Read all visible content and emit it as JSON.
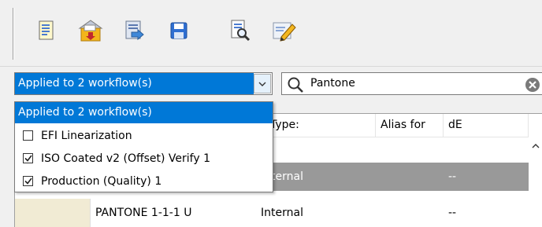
{
  "toolbar": {
    "buttons": [
      {
        "icon": "new-document-icon"
      },
      {
        "icon": "import-folder-icon"
      },
      {
        "icon": "export-icon"
      },
      {
        "icon": "save-icon"
      },
      {
        "icon": "find-in-document-icon"
      },
      {
        "icon": "edit-pencil-icon"
      }
    ]
  },
  "filter": {
    "selected": "Applied to 2 workflow(s)",
    "options": [
      {
        "label": "EFI Linearization",
        "checked": false
      },
      {
        "label": "ISO Coated v2 (Offset) Verify 1",
        "checked": true
      },
      {
        "label": "Production (Quality) 1",
        "checked": true
      }
    ]
  },
  "search": {
    "value": "Pantone"
  },
  "table": {
    "columns": {
      "type": "Type:",
      "alias": "Alias for",
      "de": "dE"
    },
    "rows": [
      {
        "name": "",
        "type": "Internal",
        "alias": "",
        "de": "--",
        "selected": true
      },
      {
        "name": "PANTONE 1-1-1 U",
        "type": "Internal",
        "alias": "",
        "de": "--",
        "selected": false
      }
    ]
  },
  "colors": {
    "selection": "#0078d7",
    "row_selected": "#999999",
    "swatch": "#f1ebd4"
  }
}
